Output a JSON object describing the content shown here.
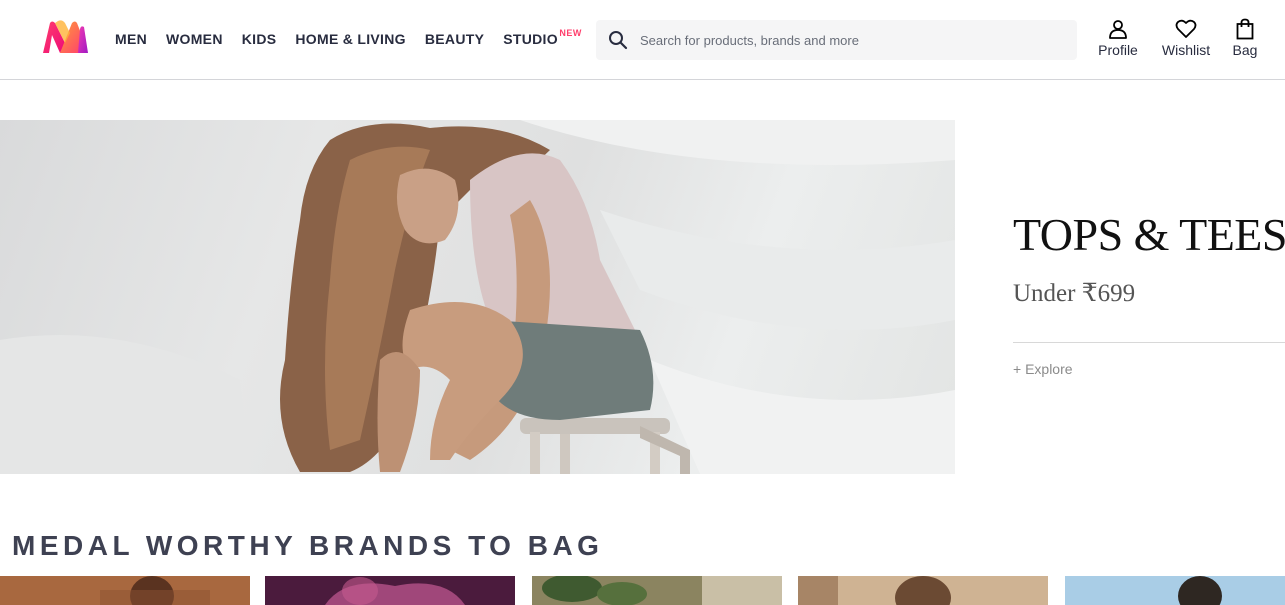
{
  "header": {
    "logo_name": "myntra-logo",
    "nav": [
      {
        "label": "MEN"
      },
      {
        "label": "WOMEN"
      },
      {
        "label": "KIDS"
      },
      {
        "label": "HOME & LIVING"
      },
      {
        "label": "BEAUTY"
      },
      {
        "label": "STUDIO",
        "badge": "NEW"
      }
    ],
    "search": {
      "placeholder": "Search for products, brands and more",
      "value": "",
      "icon": "search-icon"
    },
    "actions": [
      {
        "label": "Profile",
        "icon": "person-icon"
      },
      {
        "label": "Wishlist",
        "icon": "heart-icon"
      },
      {
        "label": "Bag",
        "icon": "bag-icon"
      }
    ]
  },
  "banner": {
    "title": "TOPS & TEES",
    "subtitle": "Under ₹699",
    "link": "+ Explore"
  },
  "section": {
    "title": "MEDAL WORTHY BRANDS TO BAG",
    "cards": [
      {
        "name": "brand-card-1"
      },
      {
        "name": "brand-card-2"
      },
      {
        "name": "brand-card-3"
      },
      {
        "name": "brand-card-4"
      },
      {
        "name": "brand-card-5"
      }
    ]
  },
  "colors": {
    "accent": "#ff3f6c",
    "text": "#282c3f",
    "search_bg": "#f5f5f6"
  }
}
